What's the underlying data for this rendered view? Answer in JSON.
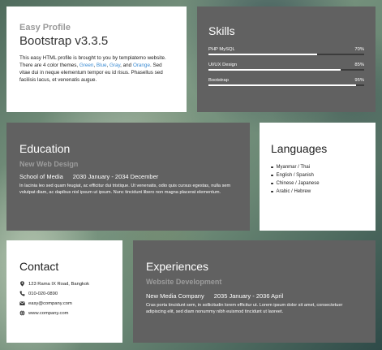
{
  "profile": {
    "subtitle": "Easy Profile",
    "title": "Bootstrap v3.3.5",
    "desc_part1": "This easy HTML profile is brought to you by templatemo website. There are 4 color themes, ",
    "theme_green": "Green",
    "sep1": ", ",
    "theme_blue": "Blue",
    "sep2": ", ",
    "theme_gray": "Gray",
    "sep3": ", and ",
    "theme_orange": "Orange",
    "desc_part2": ". Sed vitae dui in neque elementum tempor eu id risus. Phasellus sed facilisis lacus, et venenatis augue."
  },
  "skills": {
    "heading": "Skills",
    "items": [
      {
        "name": "PHP MySQL",
        "percent_label": "70%",
        "level": 0.7
      },
      {
        "name": "UI/UX Design",
        "percent_label": "85%",
        "level": 0.85
      },
      {
        "name": "Bootstrap",
        "percent_label": "95%",
        "level": 0.95
      }
    ]
  },
  "education": {
    "heading": "Education",
    "sub": "New Web Design",
    "school": "School of Media",
    "period": "2030 January - 2034 December",
    "desc": "In lacinia leo sed quam feugiat, ac efficitur dui tristique. Ut venenatis, odio quis cursus egestas, nulla sem volutpat diam, ac dapibus nisl ipsum ut ipsum. Nunc tincidunt libero non magna placerat elementum."
  },
  "languages": {
    "heading": "Languages",
    "items": [
      "Myanmar / Thai",
      "English / Spanish",
      "Chinese / Japanese",
      "Arabic / Hebrew"
    ]
  },
  "contact": {
    "heading": "Contact",
    "address": "123 Rama IX Road, Bangkok",
    "phone": "010-020-0890",
    "email": "easy@company.com",
    "website": "www.company.com"
  },
  "experiences": {
    "heading": "Experiences",
    "sub": "Website Development",
    "company": "New Media Company",
    "period": "2035 January - 2036 April",
    "desc": "Cras porta tincidunt sem, in sollicitudin lorem efficitur ut. Lorem ipsum dolor sit amet, consectetuer adipiscing elit, sed diam nonummy nibh euismod tincidunt ut laoreet."
  },
  "colors": {
    "card_dark": "#616161",
    "card_white": "#ffffff",
    "link_blue": "#3a8bd2",
    "muted_gray": "#9c9c9c"
  },
  "icons": {
    "address": "map-pin-icon",
    "phone": "phone-icon",
    "email": "envelope-icon",
    "website": "globe-icon"
  }
}
